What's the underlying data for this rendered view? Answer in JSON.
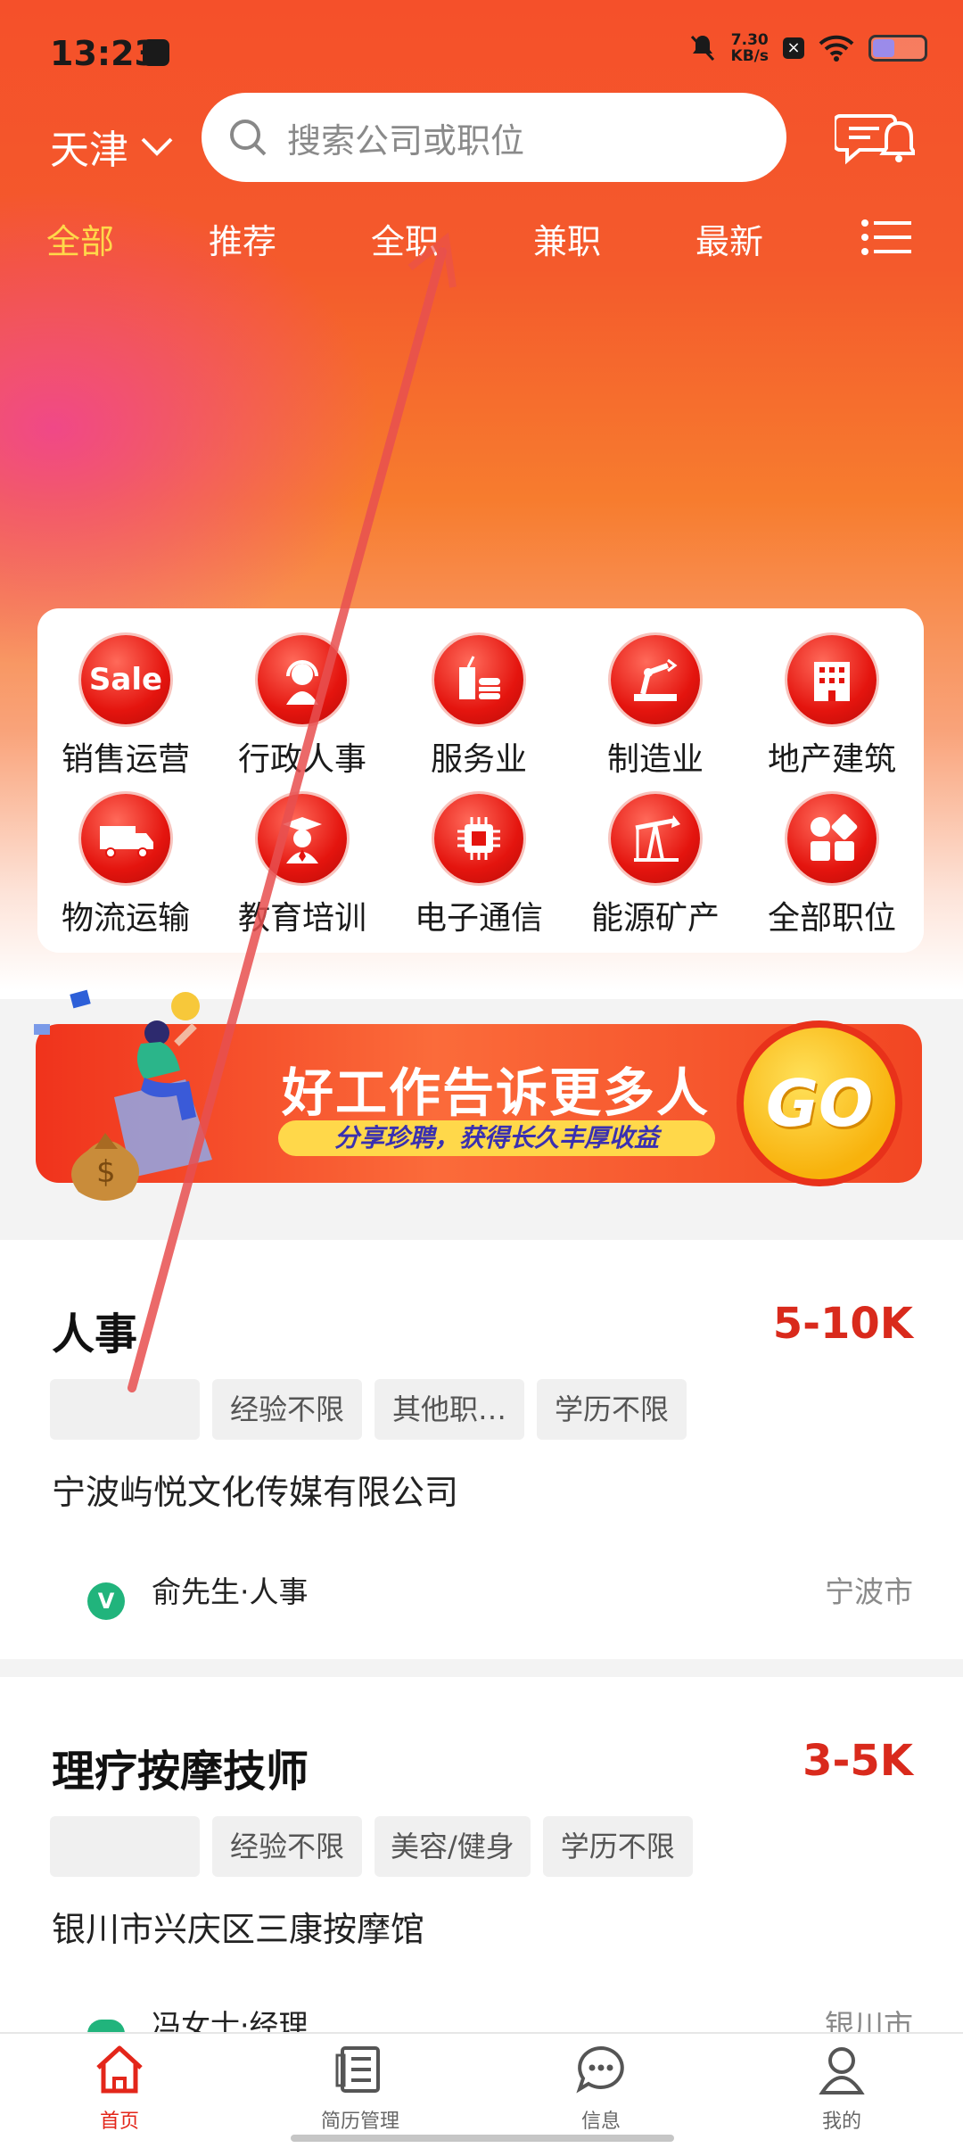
{
  "status_bar": {
    "time": "13:23",
    "speed": "7.30",
    "speed_unit": "KB/s"
  },
  "header": {
    "city": "天津",
    "search_placeholder": "搜索公司或职位"
  },
  "tabs": [
    {
      "label": "全部",
      "active": true
    },
    {
      "label": "推荐",
      "active": false
    },
    {
      "label": "全职",
      "active": false
    },
    {
      "label": "兼职",
      "active": false
    },
    {
      "label": "最新",
      "active": false
    }
  ],
  "categories": [
    {
      "label": "销售运营",
      "icon": "sale-icon",
      "icon_text": "Sale"
    },
    {
      "label": "行政人事",
      "icon": "headset-person-icon"
    },
    {
      "label": "服务业",
      "icon": "drink-burger-icon"
    },
    {
      "label": "制造业",
      "icon": "robot-arm-icon"
    },
    {
      "label": "地产建筑",
      "icon": "building-icon"
    },
    {
      "label": "物流运输",
      "icon": "truck-icon"
    },
    {
      "label": "教育培训",
      "icon": "graduate-icon"
    },
    {
      "label": "电子通信",
      "icon": "chip-icon"
    },
    {
      "label": "能源矿产",
      "icon": "oil-pump-icon"
    },
    {
      "label": "全部职位",
      "icon": "grid-shapes-icon"
    }
  ],
  "banner": {
    "title": "好工作告诉更多人",
    "subtitle": "分享珍聘，获得长久丰厚收益",
    "go_label": "GO"
  },
  "jobs": [
    {
      "title": "人事",
      "salary": "5-10K",
      "tags": [
        "",
        "经验不限",
        "其他职…",
        "学历不限"
      ],
      "company": "宁波屿悦文化传媒有限公司",
      "recruiter": "俞先生·人事",
      "verified_badge": "V",
      "city": "宁波市"
    },
    {
      "title": "理疗按摩技师",
      "salary": "3-5K",
      "tags": [
        "",
        "经验不限",
        "美容/健身",
        "学历不限"
      ],
      "company": "银川市兴庆区三康按摩馆",
      "recruiter": "冯女士·经理",
      "verified_badge": "",
      "city": "银川市"
    }
  ],
  "bottom_nav": [
    {
      "label": "首页",
      "icon": "home-icon",
      "active": true
    },
    {
      "label": "简历管理",
      "icon": "resume-icon",
      "active": false
    },
    {
      "label": "信息",
      "icon": "chat-bubble-icon",
      "active": false
    },
    {
      "label": "我的",
      "icon": "profile-icon",
      "active": false
    }
  ],
  "colors": {
    "brand": "#f4512a",
    "salary": "#d92a1c",
    "active_tab": "#ffd84a"
  }
}
